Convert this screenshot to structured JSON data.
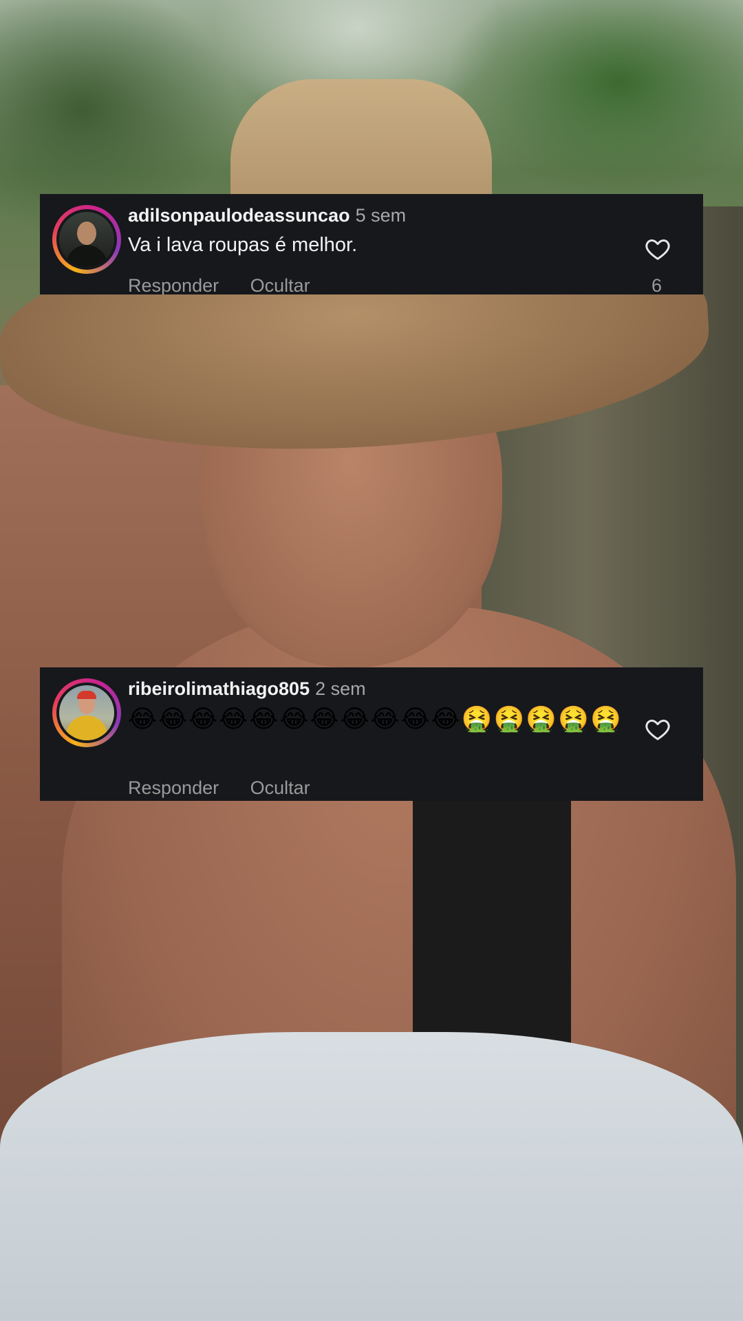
{
  "comments": [
    {
      "username": "adilsonpaulodeassuncao",
      "time": "5 sem",
      "text": "Va i lava roupas  é melhor.",
      "reply_label": "Responder",
      "hide_label": "Ocultar",
      "likes": "6",
      "avatar": "profile-photo-man-dark-shirt",
      "like_icon": "heart-outline-icon"
    },
    {
      "username": "ribeirolimathiago805",
      "time": "2 sem",
      "text": "😂😂😂😂😂😂😂😂😂😂😂🤮🤮🤮🤮🤮",
      "reply_label": "Responder",
      "hide_label": "Ocultar",
      "avatar": "profile-photo-man-red-cap-yellow-shirt",
      "like_icon": "heart-outline-icon"
    }
  ],
  "colors": {
    "comment_background": "#16181c",
    "username_text": "#f2f2f2",
    "secondary_text": "#9a9a9a"
  }
}
